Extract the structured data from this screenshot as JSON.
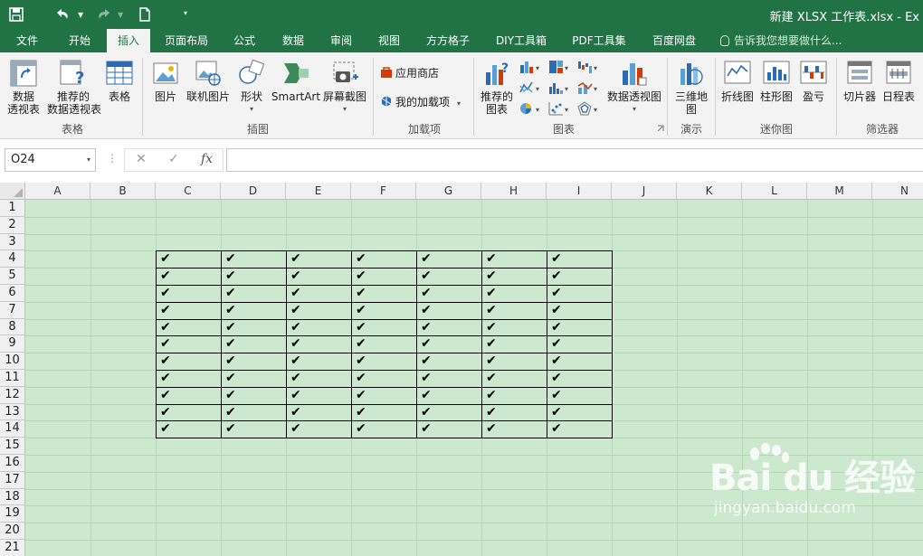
{
  "window": {
    "title": "新建 XLSX 工作表.xlsx - Ex"
  },
  "tabs": [
    "文件",
    "开始",
    "插入",
    "页面布局",
    "公式",
    "数据",
    "审阅",
    "视图",
    "方方格子",
    "DIY工具箱",
    "PDF工具集",
    "百度网盘"
  ],
  "active_tab": "插入",
  "tell_me": "告诉我您想要做什么...",
  "ribbon": {
    "groups": {
      "tables": "表格",
      "illustrations": "插图",
      "addins": "加载项",
      "charts": "图表",
      "tours": "演示",
      "sparklines": "迷你图",
      "filters": "筛选器"
    },
    "buttons": {
      "pivot_table": [
        "数据",
        "透视表"
      ],
      "recommended_pivot": [
        "推荐的",
        "数据透视表"
      ],
      "table": "表格",
      "picture": "图片",
      "online_picture": "联机图片",
      "shapes": "形状",
      "smartart": "SmartArt",
      "screenshot": "屏幕截图",
      "store": "应用商店",
      "my_addins": "我的加载项",
      "recommended_charts": [
        "推荐的",
        "图表"
      ],
      "pivot_chart": "数据透视图",
      "map_3d": [
        "三维地",
        "图"
      ],
      "line": "折线图",
      "column": "柱形图",
      "win_loss": "盈亏",
      "slicer": "切片器",
      "timeline": "日程表"
    }
  },
  "formula_bar": {
    "name_box": "O24",
    "cancel_symbol": "✕",
    "enter_symbol": "✓",
    "fx_symbol": "fx",
    "value": ""
  },
  "sheet": {
    "columns": [
      "A",
      "B",
      "C",
      "D",
      "E",
      "F",
      "G",
      "H",
      "I",
      "J",
      "K",
      "L",
      "M",
      "N"
    ],
    "rows": [
      "1",
      "2",
      "3",
      "4",
      "5",
      "6",
      "7",
      "8",
      "9",
      "10",
      "11",
      "12",
      "13",
      "14",
      "15",
      "16",
      "17",
      "18",
      "19",
      "20",
      "21"
    ],
    "checkmark": "✔",
    "table_range": "C4:I14"
  },
  "watermark": {
    "logo": "Bai du 经验",
    "url": "jingyan.baidu.com"
  },
  "colors": {
    "accent": "#217346",
    "sheet_bg": "#cce8cf"
  }
}
